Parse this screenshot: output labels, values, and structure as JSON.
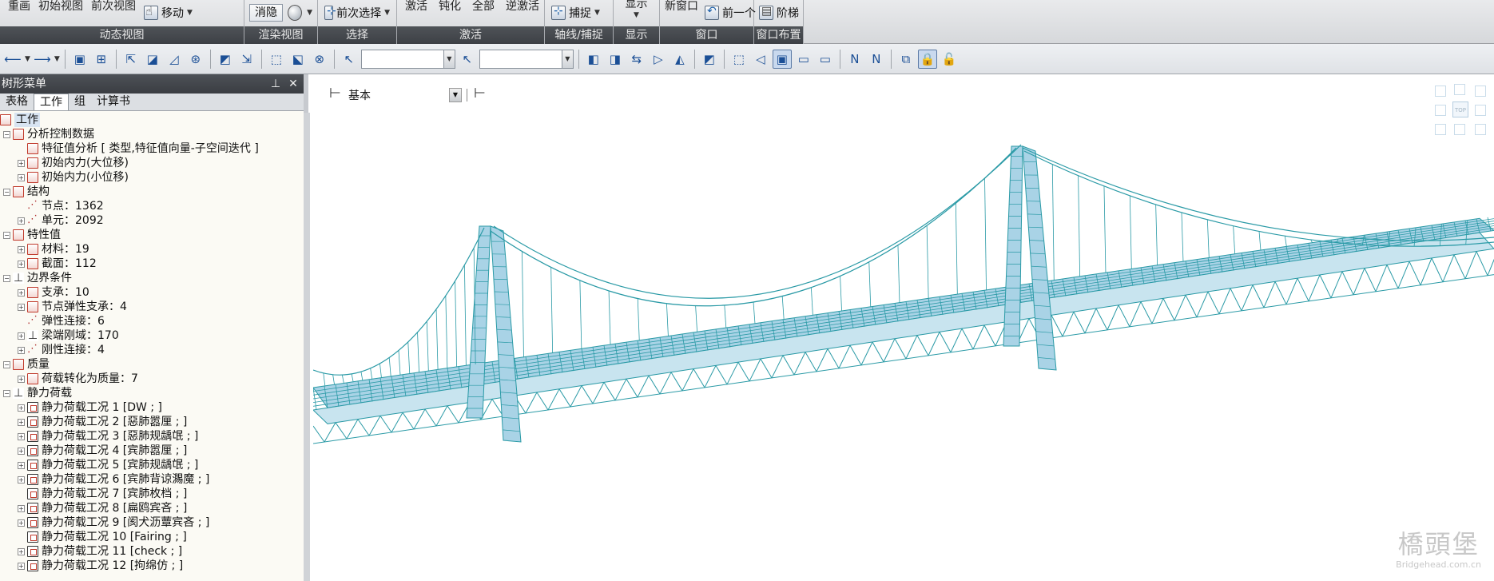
{
  "ribbon": {
    "groups": [
      {
        "title": "动态视图",
        "buttons": [
          "重画",
          "初始视图",
          "前次视图",
          "移动"
        ]
      },
      {
        "title": "渲染视图",
        "buttons": [
          "消隐"
        ]
      },
      {
        "title": "选择",
        "buttons": [
          "前次选择"
        ]
      },
      {
        "title": "激活",
        "buttons": [
          "激活",
          "钝化",
          "全部",
          "逆激活"
        ]
      },
      {
        "title": "轴线/捕捉",
        "buttons": [
          "捕捉"
        ]
      },
      {
        "title": "显示",
        "buttons": [
          "显示"
        ]
      },
      {
        "title": "窗口",
        "buttons": [
          "新窗口",
          "前一个"
        ]
      },
      {
        "title": "窗口布置",
        "buttons": [
          "阶梯"
        ]
      }
    ]
  },
  "panel": {
    "title": "树形菜单",
    "tabs": [
      "表格",
      "工作",
      "组",
      "计算书"
    ],
    "active_tab": "工作"
  },
  "tree": {
    "root": "工作",
    "items": [
      {
        "label": "分析控制数据",
        "level": 1,
        "toggle": "-",
        "icon": "red"
      },
      {
        "label": "特征值分析 [ 类型,特征值向量-子空间迭代 ]",
        "level": 2,
        "toggle": "",
        "icon": "red"
      },
      {
        "label": "初始内力(大位移)",
        "level": 2,
        "toggle": "+",
        "icon": "red"
      },
      {
        "label": "初始内力(小位移)",
        "level": 2,
        "toggle": "+",
        "icon": "red"
      },
      {
        "label": "结构",
        "level": 1,
        "toggle": "-",
        "icon": "red"
      },
      {
        "label": "节点：1362",
        "level": 2,
        "toggle": "",
        "icon": "node"
      },
      {
        "label": "单元：2092",
        "level": 2,
        "toggle": "+",
        "icon": "node"
      },
      {
        "label": "特性值",
        "level": 1,
        "toggle": "-",
        "icon": "red"
      },
      {
        "label": "材料：19",
        "level": 2,
        "toggle": "+",
        "icon": "red"
      },
      {
        "label": "截面：112",
        "level": 2,
        "toggle": "+",
        "icon": "red"
      },
      {
        "label": "边界条件",
        "level": 1,
        "toggle": "-",
        "icon": "bc"
      },
      {
        "label": "支承：10",
        "level": 2,
        "toggle": "+",
        "icon": "red"
      },
      {
        "label": "节点弹性支承：4",
        "level": 2,
        "toggle": "+",
        "icon": "red"
      },
      {
        "label": "弹性连接：6",
        "level": 2,
        "toggle": "",
        "icon": "node"
      },
      {
        "label": "梁端刚域：170",
        "level": 2,
        "toggle": "+",
        "icon": "bc"
      },
      {
        "label": "刚性连接：4",
        "level": 2,
        "toggle": "+",
        "icon": "node"
      },
      {
        "label": "质量",
        "level": 1,
        "toggle": "-",
        "icon": "red"
      },
      {
        "label": "荷载转化为质量：7",
        "level": 2,
        "toggle": "+",
        "icon": "red"
      },
      {
        "label": "静力荷载",
        "level": 1,
        "toggle": "-",
        "icon": "bc"
      },
      {
        "label": "静力荷载工况 1 [DW ; ]",
        "level": 2,
        "toggle": "+",
        "icon": "load"
      },
      {
        "label": "静力荷载工况 2 [惡肺嚣厘 ; ]",
        "level": 2,
        "toggle": "+",
        "icon": "load"
      },
      {
        "label": "静力荷载工况 3 [惡肺规龋氓 ; ]",
        "level": 2,
        "toggle": "+",
        "icon": "load"
      },
      {
        "label": "静力荷载工况 4 [宾肺嚣厘 ; ]",
        "level": 2,
        "toggle": "+",
        "icon": "load"
      },
      {
        "label": "静力荷载工况 5 [宾肺规龋氓 ; ]",
        "level": 2,
        "toggle": "+",
        "icon": "load"
      },
      {
        "label": "静力荷载工况 6 [宾肺背谅瀃魔 ; ]",
        "level": 2,
        "toggle": "+",
        "icon": "load"
      },
      {
        "label": "静力荷载工况 7 [宾肺枚档 ; ]",
        "level": 2,
        "toggle": "",
        "icon": "load"
      },
      {
        "label": "静力荷载工况 8 [扁鸥宾吝 ; ]",
        "level": 2,
        "toggle": "+",
        "icon": "load"
      },
      {
        "label": "静力荷载工况 9 [阂犬沥蕈宾吝 ; ]",
        "level": 2,
        "toggle": "+",
        "icon": "load"
      },
      {
        "label": "静力荷载工况 10 [Fairing ; ]",
        "level": 2,
        "toggle": "",
        "icon": "load"
      },
      {
        "label": "静力荷载工况 11 [check ; ]",
        "level": 2,
        "toggle": "+",
        "icon": "load"
      },
      {
        "label": "静力荷载工况 12 [拘绵仿 ; ]",
        "level": 2,
        "toggle": "+",
        "icon": "load"
      }
    ]
  },
  "viewport": {
    "combo_value": "基本",
    "viewcube_face": "TOP",
    "watermark_name": "橋頭堡",
    "watermark_url": "Bridgehead.com.cn"
  },
  "colors": {
    "model": "#2a9aa6",
    "deck": "#a9d3e6",
    "ribbon_title_bg": "#3d4045",
    "panel_header_bg": "#3a3d42"
  },
  "icons": [
    "hand-icon",
    "globe-icon",
    "cursor-icon",
    "snap-icon",
    "prev-window-icon",
    "stairs-icon"
  ]
}
